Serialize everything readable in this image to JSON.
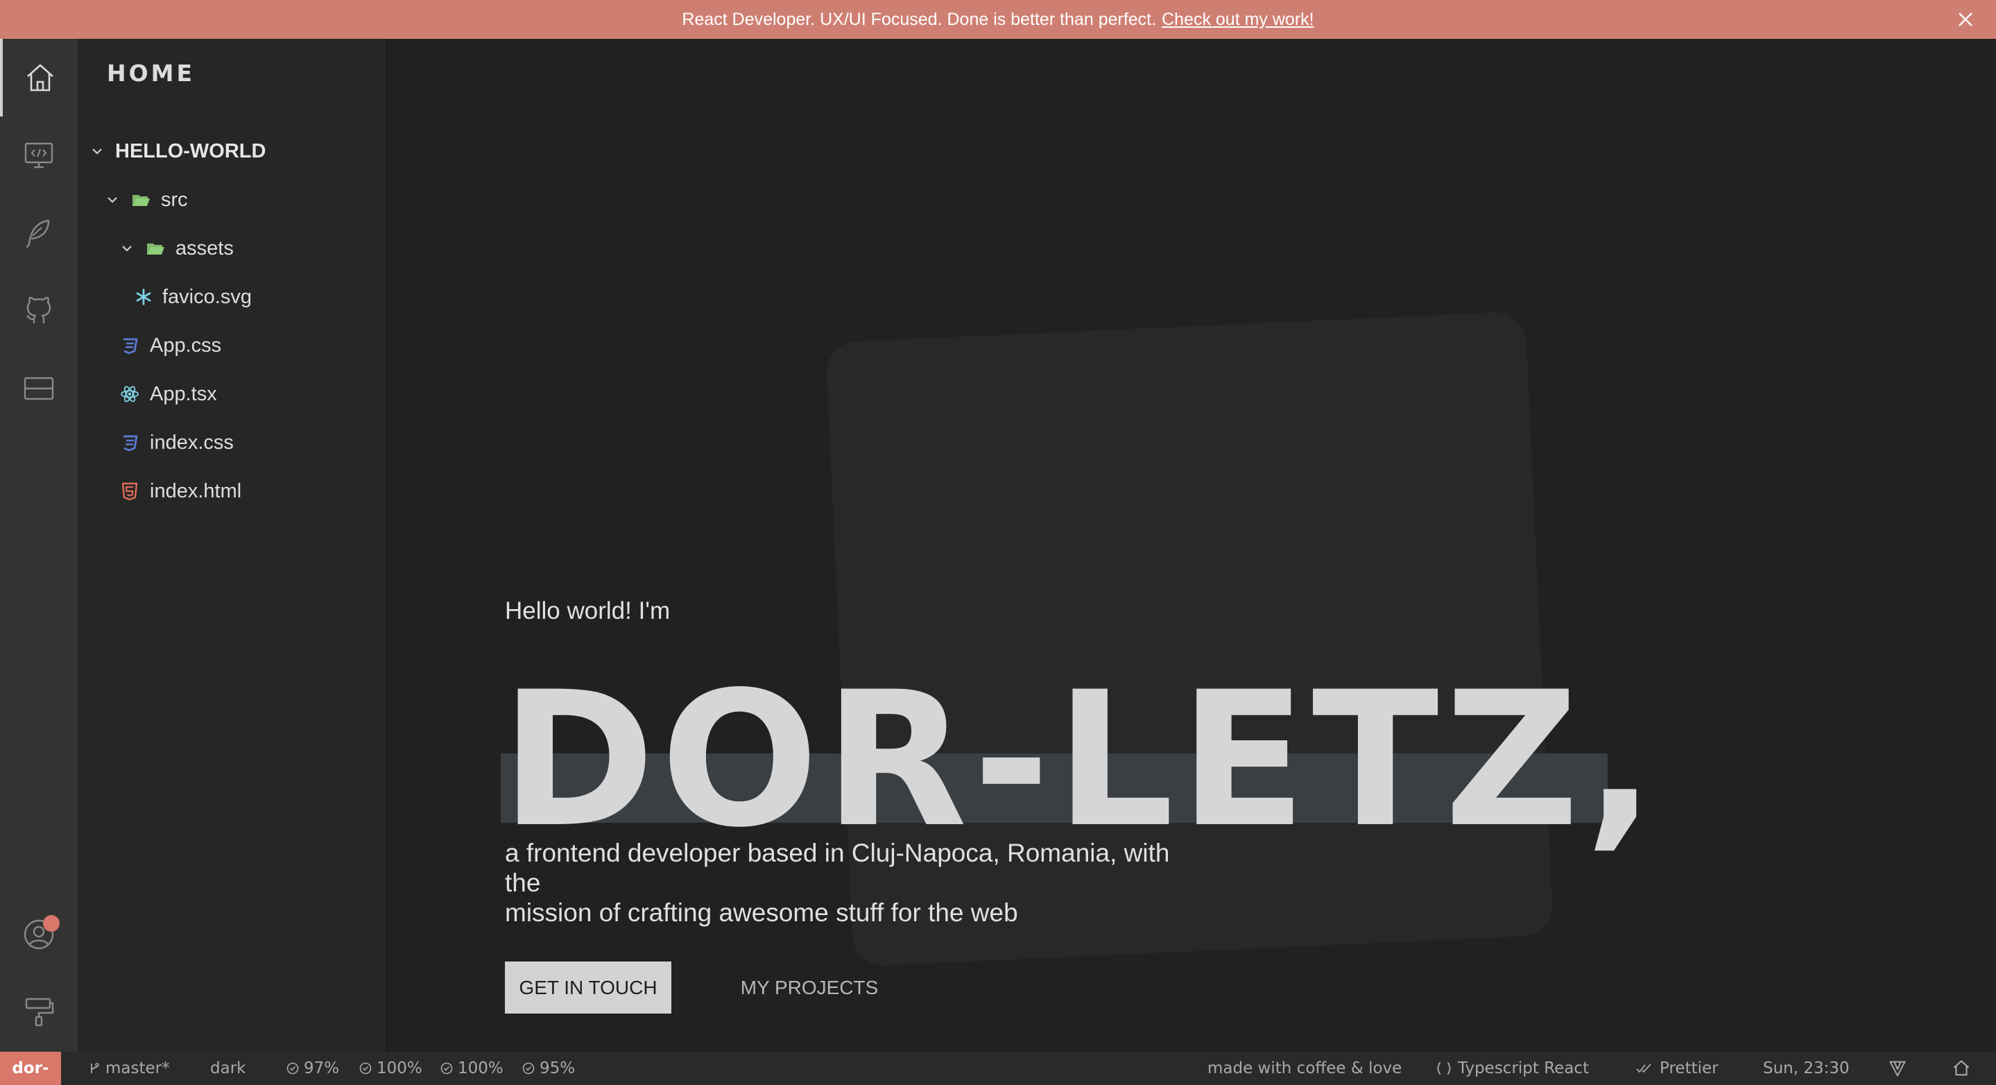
{
  "banner": {
    "text": "React Developer. UX/UI Focused. Done is better than perfect.",
    "link": "Check out my work!"
  },
  "activity_bar": {
    "items": [
      "home-icon",
      "code-monitor-icon",
      "feather-icon",
      "github-icon",
      "layout-icon"
    ],
    "bottom_items": [
      "account-icon",
      "paint-roller-icon"
    ]
  },
  "explorer": {
    "title": "HOME",
    "root": "HELLO-WORLD",
    "items": [
      {
        "label": "src",
        "icon": "folder-open-icon"
      },
      {
        "label": "assets",
        "icon": "folder-open-icon"
      },
      {
        "label": "favico.svg",
        "icon": "svg-file-icon"
      },
      {
        "label": "App.css",
        "icon": "css-file-icon"
      },
      {
        "label": "App.tsx",
        "icon": "react-file-icon"
      },
      {
        "label": "index.css",
        "icon": "css-file-icon"
      },
      {
        "label": "index.html",
        "icon": "html-file-icon"
      }
    ]
  },
  "hero": {
    "greeting": "Hello world! I'm",
    "name": "DOR-LETZ,",
    "tagline_line1": "a frontend developer based in Cluj-Napoca, Romania, with the",
    "tagline_line2": "mission of crafting awesome stuff for the web",
    "primary_button": "GET IN TOUCH",
    "secondary_button": "MY PROJECTS"
  },
  "status_bar": {
    "brand": "dor-",
    "branch": "master*",
    "theme": "dark",
    "metrics": [
      "97%",
      "100%",
      "100%",
      "95%"
    ],
    "made_with": "made with coffee & love",
    "language": "Typescript React",
    "formatter": "Prettier",
    "datetime": "Sun, 23:30"
  },
  "colors": {
    "accent": "#d9776b",
    "banner_bg": "#cf7f72",
    "editor_bg": "#212121",
    "sidebar_bg": "#262626",
    "activity_bg": "#333333",
    "folder_green": "#8fce7a",
    "css_blue": "#5b7bd5",
    "react_cyan": "#7fd4e6",
    "html_red": "#e06c5a"
  }
}
